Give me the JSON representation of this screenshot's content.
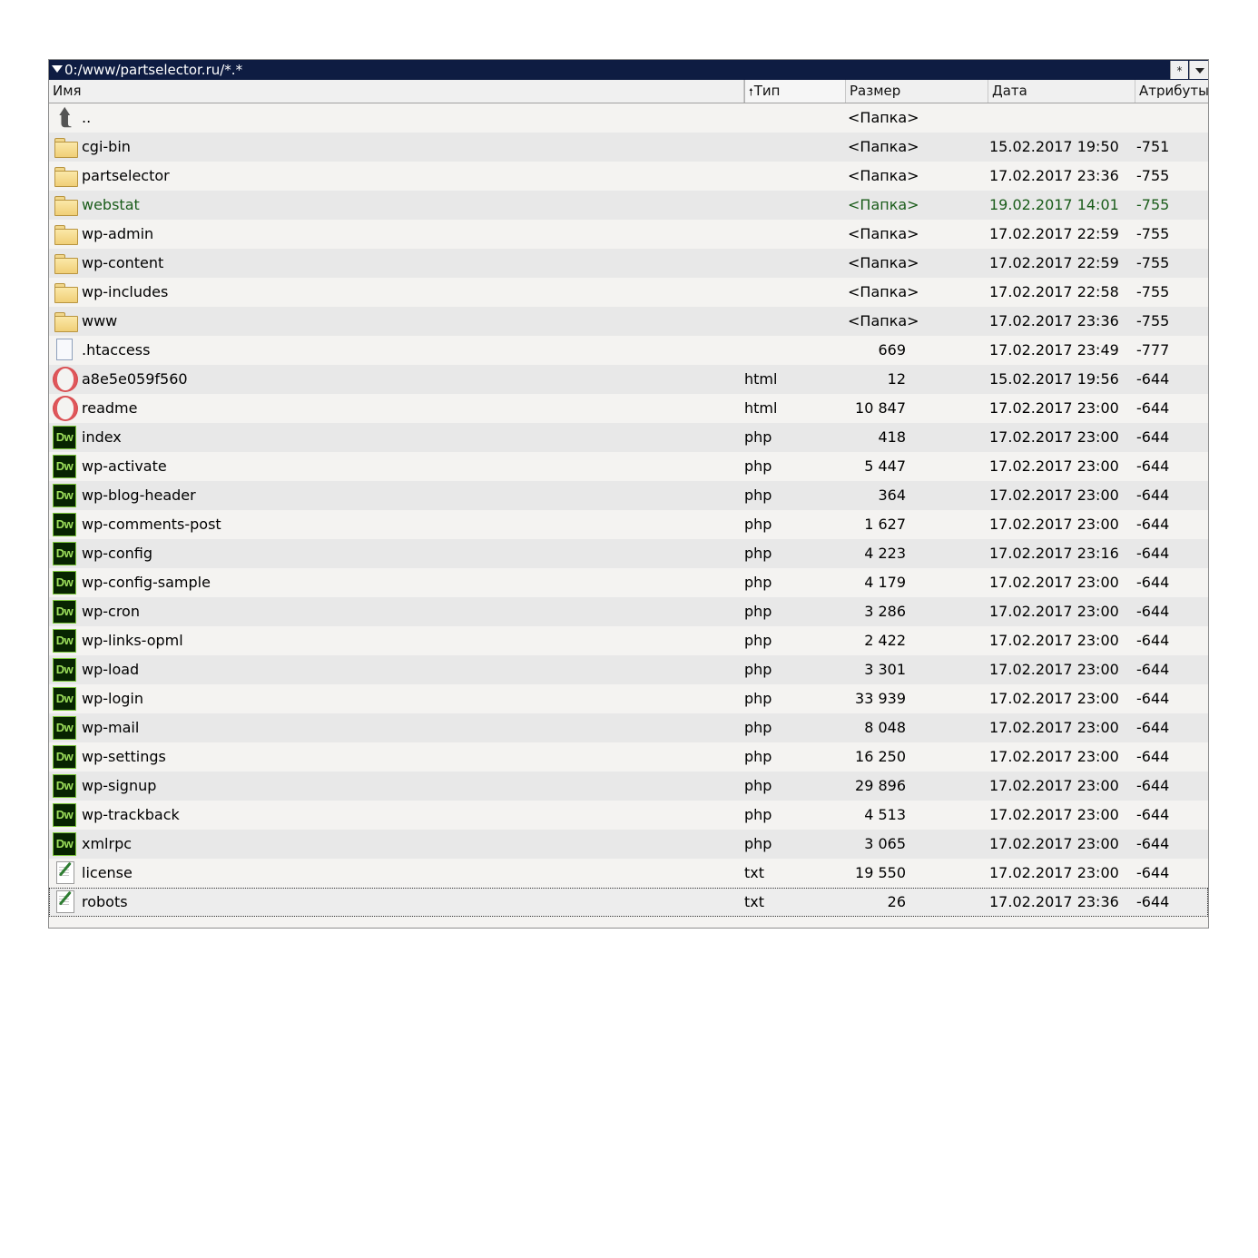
{
  "window": {
    "path": "0:/www/partselector.ru/*.*",
    "star_button": "*"
  },
  "columns": {
    "name": "Имя",
    "type": "Тип",
    "size": "Размер",
    "date": "Дата",
    "attributes": "Атрибуты",
    "sort_indicator": "🠕"
  },
  "rows": [
    {
      "icon": "up-folder-icon",
      "name": "..",
      "type": "",
      "size": "<Папка>",
      "date": "",
      "attr": ""
    },
    {
      "icon": "folder-icon",
      "name": "cgi-bin",
      "type": "",
      "size": "<Папка>",
      "date": "15.02.2017 19:50",
      "attr": "-751"
    },
    {
      "icon": "folder-icon",
      "name": "partselector",
      "type": "",
      "size": "<Папка>",
      "date": "17.02.2017 23:36",
      "attr": "-755"
    },
    {
      "icon": "folder-icon",
      "name": "webstat",
      "type": "",
      "size": "<Папка>",
      "date": "19.02.2017 14:01",
      "attr": "-755",
      "highlight": "#1a5c1a"
    },
    {
      "icon": "folder-icon",
      "name": "wp-admin",
      "type": "",
      "size": "<Папка>",
      "date": "17.02.2017 22:59",
      "attr": "-755"
    },
    {
      "icon": "folder-icon",
      "name": "wp-content",
      "type": "",
      "size": "<Папка>",
      "date": "17.02.2017 22:59",
      "attr": "-755"
    },
    {
      "icon": "folder-icon",
      "name": "wp-includes",
      "type": "",
      "size": "<Папка>",
      "date": "17.02.2017 22:58",
      "attr": "-755"
    },
    {
      "icon": "folder-icon",
      "name": "www",
      "type": "",
      "size": "<Папка>",
      "date": "17.02.2017 23:36",
      "attr": "-755"
    },
    {
      "icon": "file-icon",
      "name": ".htaccess",
      "type": "",
      "size": "669",
      "date": "17.02.2017 23:49",
      "attr": "-777"
    },
    {
      "icon": "opera-icon",
      "name": "a8e5e059f560",
      "type": "html",
      "size": "12",
      "date": "15.02.2017 19:56",
      "attr": "-644"
    },
    {
      "icon": "opera-icon",
      "name": "readme",
      "type": "html",
      "size": "10 847",
      "date": "17.02.2017 23:00",
      "attr": "-644"
    },
    {
      "icon": "dreamweaver-icon",
      "name": "index",
      "type": "php",
      "size": "418",
      "date": "17.02.2017 23:00",
      "attr": "-644"
    },
    {
      "icon": "dreamweaver-icon",
      "name": "wp-activate",
      "type": "php",
      "size": "5 447",
      "date": "17.02.2017 23:00",
      "attr": "-644"
    },
    {
      "icon": "dreamweaver-icon",
      "name": "wp-blog-header",
      "type": "php",
      "size": "364",
      "date": "17.02.2017 23:00",
      "attr": "-644"
    },
    {
      "icon": "dreamweaver-icon",
      "name": "wp-comments-post",
      "type": "php",
      "size": "1 627",
      "date": "17.02.2017 23:00",
      "attr": "-644"
    },
    {
      "icon": "dreamweaver-icon",
      "name": "wp-config",
      "type": "php",
      "size": "4 223",
      "date": "17.02.2017 23:16",
      "attr": "-644"
    },
    {
      "icon": "dreamweaver-icon",
      "name": "wp-config-sample",
      "type": "php",
      "size": "4 179",
      "date": "17.02.2017 23:00",
      "attr": "-644"
    },
    {
      "icon": "dreamweaver-icon",
      "name": "wp-cron",
      "type": "php",
      "size": "3 286",
      "date": "17.02.2017 23:00",
      "attr": "-644"
    },
    {
      "icon": "dreamweaver-icon",
      "name": "wp-links-opml",
      "type": "php",
      "size": "2 422",
      "date": "17.02.2017 23:00",
      "attr": "-644"
    },
    {
      "icon": "dreamweaver-icon",
      "name": "wp-load",
      "type": "php",
      "size": "3 301",
      "date": "17.02.2017 23:00",
      "attr": "-644"
    },
    {
      "icon": "dreamweaver-icon",
      "name": "wp-login",
      "type": "php",
      "size": "33 939",
      "date": "17.02.2017 23:00",
      "attr": "-644"
    },
    {
      "icon": "dreamweaver-icon",
      "name": "wp-mail",
      "type": "php",
      "size": "8 048",
      "date": "17.02.2017 23:00",
      "attr": "-644"
    },
    {
      "icon": "dreamweaver-icon",
      "name": "wp-settings",
      "type": "php",
      "size": "16 250",
      "date": "17.02.2017 23:00",
      "attr": "-644"
    },
    {
      "icon": "dreamweaver-icon",
      "name": "wp-signup",
      "type": "php",
      "size": "29 896",
      "date": "17.02.2017 23:00",
      "attr": "-644"
    },
    {
      "icon": "dreamweaver-icon",
      "name": "wp-trackback",
      "type": "php",
      "size": "4 513",
      "date": "17.02.2017 23:00",
      "attr": "-644"
    },
    {
      "icon": "dreamweaver-icon",
      "name": "xmlrpc",
      "type": "php",
      "size": "3 065",
      "date": "17.02.2017 23:00",
      "attr": "-644"
    },
    {
      "icon": "text-file-icon",
      "name": "license",
      "type": "txt",
      "size": "19 550",
      "date": "17.02.2017 23:00",
      "attr": "-644"
    },
    {
      "icon": "text-file-icon",
      "name": "robots",
      "type": "txt",
      "size": "26",
      "date": "17.02.2017 23:36",
      "attr": "-644",
      "focused": true
    }
  ]
}
